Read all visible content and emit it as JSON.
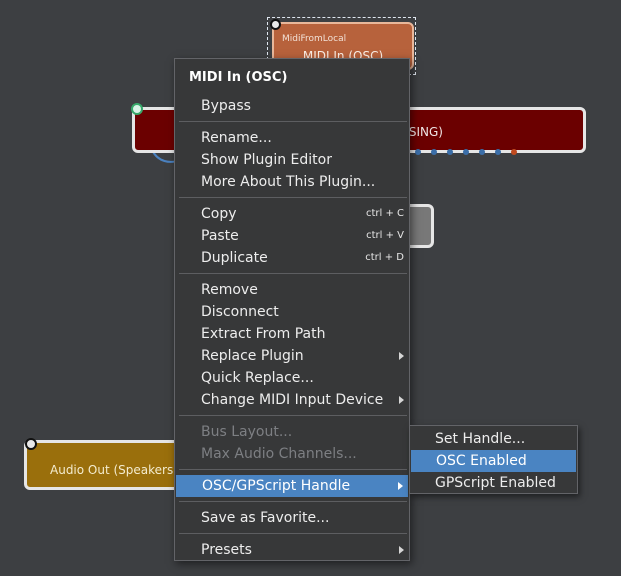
{
  "canvas": {
    "midi_node": {
      "small_label": "MidiFromLocal",
      "title": "MIDI In (OSC)"
    },
    "red_node": {
      "label_fragment": "SING)"
    },
    "audio_node": {
      "label": "Audio Out (Speakers"
    }
  },
  "context_menu": {
    "title": "MIDI In (OSC)",
    "bypass": "Bypass",
    "rename": "Rename...",
    "show_plugin_editor": "Show Plugin Editor",
    "more_about": "More About This Plugin...",
    "copy": "Copy",
    "copy_shortcut": "ctrl + C",
    "paste": "Paste",
    "paste_shortcut": "ctrl + V",
    "duplicate": "Duplicate",
    "duplicate_shortcut": "ctrl + D",
    "remove": "Remove",
    "disconnect": "Disconnect",
    "extract_from_path": "Extract From Path",
    "replace_plugin": "Replace Plugin",
    "quick_replace": "Quick Replace...",
    "change_midi_input": "Change MIDI Input Device",
    "bus_layout": "Bus Layout...",
    "max_audio_channels": "Max Audio Channels...",
    "osc_gpscript_handle": "OSC/GPScript Handle",
    "save_as_favorite": "Save as Favorite...",
    "presets": "Presets"
  },
  "submenu": {
    "set_handle": "Set Handle...",
    "osc_enabled": "OSC Enabled",
    "gpscript_enabled": "GPScript Enabled"
  },
  "colors": {
    "highlight": "#4a84c2",
    "menu_bg": "#373839",
    "canvas_bg": "#3d3f42"
  }
}
